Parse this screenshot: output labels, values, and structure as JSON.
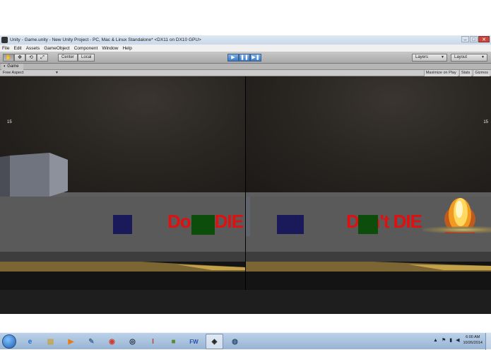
{
  "window": {
    "title": "Unity - Game.unity - New Unity Project - PC, Mac & Linux Standalone* <DX11 on DX10 GPU>",
    "minimize": "–",
    "maximize": "□",
    "close": "✕"
  },
  "menu": [
    "File",
    "Edit",
    "Assets",
    "GameObject",
    "Component",
    "Window",
    "Help"
  ],
  "toolbar": {
    "transform_tools": [
      "✋",
      "✥",
      "⟲",
      "⤢"
    ],
    "pivot": "Center",
    "space": "Local",
    "play": "▶",
    "pause": "❚❚",
    "step": "▶❚",
    "layers": "Layers",
    "layout": "Layout"
  },
  "game_tab": {
    "label": "Game",
    "aspect": "Free Aspect",
    "options": [
      "Maximize on Play",
      "Stats",
      "Gizmos"
    ]
  },
  "viewport_left": {
    "fps": "15",
    "text": "Don't DIE"
  },
  "viewport_right": {
    "fps": "15",
    "text": "Don't DIE"
  },
  "taskbar": {
    "apps": [
      {
        "icon": "internet-explorer-icon",
        "glyph": "e",
        "color": "#1c6fd1"
      },
      {
        "icon": "file-explorer-icon",
        "glyph": "▤",
        "color": "#c7a33a"
      },
      {
        "icon": "media-player-icon",
        "glyph": "▶",
        "color": "#e87b10"
      },
      {
        "icon": "tools-icon",
        "glyph": "✎",
        "color": "#4a6fa0"
      },
      {
        "icon": "chrome-icon",
        "glyph": "◉",
        "color": "#d13b2e"
      },
      {
        "icon": "steam-icon",
        "glyph": "◎",
        "color": "#1b2838"
      },
      {
        "icon": "installer-icon",
        "glyph": "I",
        "color": "#b54a24"
      },
      {
        "icon": "minecraft-icon",
        "glyph": "■",
        "color": "#5a8a32"
      },
      {
        "icon": "fireworks-icon",
        "glyph": "FW",
        "color": "#2a4fa8"
      },
      {
        "icon": "unity-icon",
        "glyph": "◈",
        "color": "#222222"
      },
      {
        "icon": "search-app-icon",
        "glyph": "◍",
        "color": "#2f4f70"
      }
    ],
    "time": "6:00 AM",
    "date": "10/26/2014"
  }
}
